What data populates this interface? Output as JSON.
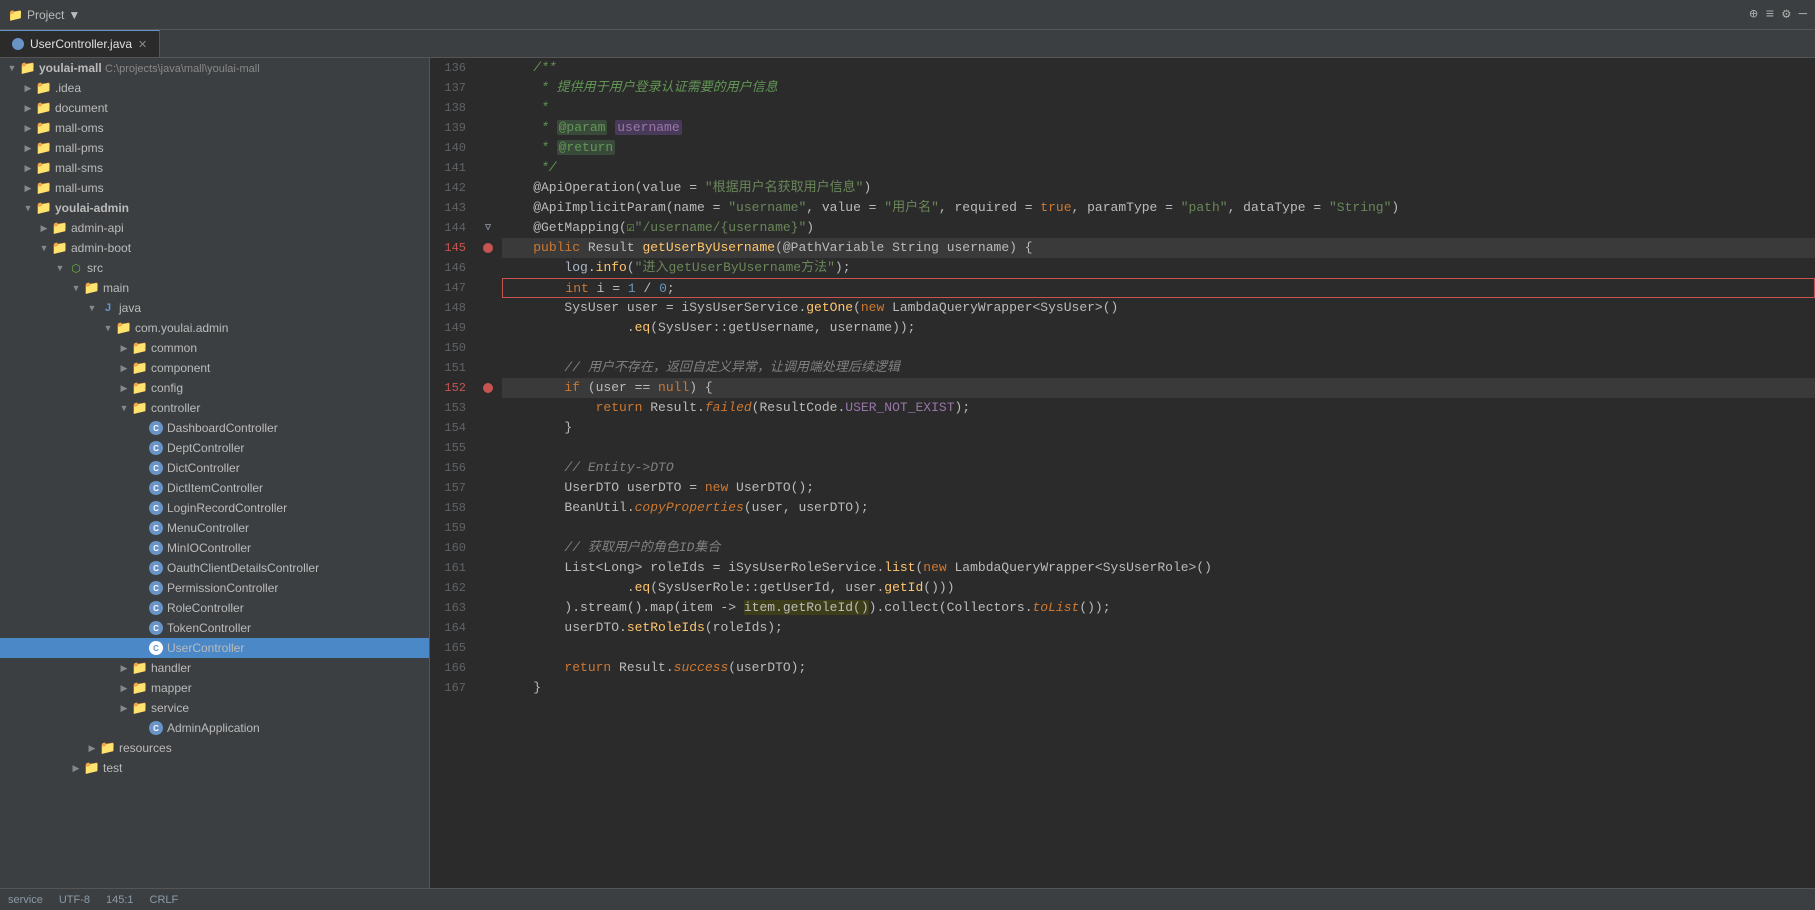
{
  "titleBar": {
    "projectLabel": "Project",
    "dropdownIcon": "▼"
  },
  "tabs": [
    {
      "label": "UserController.java",
      "active": true,
      "closeable": true
    }
  ],
  "sidebar": {
    "title": "Project",
    "tree": [
      {
        "indent": 0,
        "arrow": "▼",
        "icon": "folder",
        "label": "youlai-mall",
        "suffix": " C:\\projects\\java\\mall\\youlai-mall",
        "selected": false
      },
      {
        "indent": 1,
        "arrow": "▶",
        "icon": "folder",
        "label": ".idea",
        "selected": false
      },
      {
        "indent": 1,
        "arrow": "▶",
        "icon": "folder",
        "label": "document",
        "selected": false
      },
      {
        "indent": 1,
        "arrow": "▶",
        "icon": "folder",
        "label": "mall-oms",
        "selected": false
      },
      {
        "indent": 1,
        "arrow": "▶",
        "icon": "folder",
        "label": "mall-pms",
        "selected": false
      },
      {
        "indent": 1,
        "arrow": "▶",
        "icon": "folder",
        "label": "mall-sms",
        "selected": false
      },
      {
        "indent": 1,
        "arrow": "▶",
        "icon": "folder",
        "label": "mall-ums",
        "selected": false
      },
      {
        "indent": 1,
        "arrow": "▼",
        "icon": "folder",
        "label": "youlai-admin",
        "selected": false
      },
      {
        "indent": 2,
        "arrow": "▶",
        "icon": "folder",
        "label": "admin-api",
        "selected": false
      },
      {
        "indent": 2,
        "arrow": "▼",
        "icon": "folder",
        "label": "admin-boot",
        "selected": false
      },
      {
        "indent": 3,
        "arrow": "▼",
        "icon": "src",
        "label": "src",
        "selected": false
      },
      {
        "indent": 4,
        "arrow": "▼",
        "icon": "folder",
        "label": "main",
        "selected": false
      },
      {
        "indent": 5,
        "arrow": "▼",
        "icon": "folder",
        "label": "java",
        "selected": false
      },
      {
        "indent": 6,
        "arrow": "▼",
        "icon": "folder",
        "label": "com.youlai.admin",
        "selected": false
      },
      {
        "indent": 7,
        "arrow": "▶",
        "icon": "folder",
        "label": "common",
        "selected": false
      },
      {
        "indent": 7,
        "arrow": "▶",
        "icon": "folder",
        "label": "component",
        "selected": false
      },
      {
        "indent": 7,
        "arrow": "▶",
        "icon": "folder",
        "label": "config",
        "selected": false
      },
      {
        "indent": 7,
        "arrow": "▼",
        "icon": "folder",
        "label": "controller",
        "selected": false
      },
      {
        "indent": 8,
        "arrow": "",
        "icon": "controller",
        "label": "DashboardController",
        "selected": false
      },
      {
        "indent": 8,
        "arrow": "",
        "icon": "controller",
        "label": "DeptController",
        "selected": false
      },
      {
        "indent": 8,
        "arrow": "",
        "icon": "controller",
        "label": "DictController",
        "selected": false
      },
      {
        "indent": 8,
        "arrow": "",
        "icon": "controller",
        "label": "DictItemController",
        "selected": false
      },
      {
        "indent": 8,
        "arrow": "",
        "icon": "controller",
        "label": "LoginRecordController",
        "selected": false
      },
      {
        "indent": 8,
        "arrow": "",
        "icon": "controller",
        "label": "MenuController",
        "selected": false
      },
      {
        "indent": 8,
        "arrow": "",
        "icon": "controller",
        "label": "MinIOController",
        "selected": false
      },
      {
        "indent": 8,
        "arrow": "",
        "icon": "controller",
        "label": "OauthClientDetailsController",
        "selected": false
      },
      {
        "indent": 8,
        "arrow": "",
        "icon": "controller",
        "label": "PermissionController",
        "selected": false
      },
      {
        "indent": 8,
        "arrow": "",
        "icon": "controller",
        "label": "RoleController",
        "selected": false
      },
      {
        "indent": 8,
        "arrow": "",
        "icon": "controller",
        "label": "TokenController",
        "selected": false
      },
      {
        "indent": 8,
        "arrow": "",
        "icon": "controller",
        "label": "UserController",
        "selected": true
      },
      {
        "indent": 7,
        "arrow": "▶",
        "icon": "folder",
        "label": "handler",
        "selected": false
      },
      {
        "indent": 7,
        "arrow": "▶",
        "icon": "folder",
        "label": "mapper",
        "selected": false
      },
      {
        "indent": 7,
        "arrow": "▶",
        "icon": "folder",
        "label": "service",
        "selected": false
      },
      {
        "indent": 8,
        "arrow": "",
        "icon": "controller",
        "label": "AdminApplication",
        "selected": false
      },
      {
        "indent": 6,
        "arrow": "▶",
        "icon": "folder",
        "label": "resources",
        "selected": false
      },
      {
        "indent": 5,
        "arrow": "▶",
        "icon": "folder",
        "label": "test",
        "selected": false
      }
    ]
  },
  "editor": {
    "filename": "UserController.java",
    "lines": [
      {
        "num": 136,
        "content": "    /**",
        "type": "comment"
      },
      {
        "num": 137,
        "content": "     * 提供用于用户登录认证需要的用户信息",
        "type": "comment"
      },
      {
        "num": 138,
        "content": "     *",
        "type": "comment"
      },
      {
        "num": 139,
        "content": "     * @param username",
        "type": "comment-param"
      },
      {
        "num": 140,
        "content": "     * @return",
        "type": "comment-return"
      },
      {
        "num": 141,
        "content": "     */",
        "type": "comment"
      },
      {
        "num": 142,
        "content": "    @ApiOperation(value = \"根据用户名获取用户信息\")",
        "type": "annotation"
      },
      {
        "num": 143,
        "content": "    @ApiImplicitParam(name = \"username\", value = \"用户名\", required = true, paramType = \"path\", dataType = \"String\")",
        "type": "annotation"
      },
      {
        "num": 144,
        "content": "    @GetMapping(☑\"/username/{username}\")",
        "type": "annotation"
      },
      {
        "num": 145,
        "content": "    public Result getUserByUsername(@PathVariable String username) {",
        "type": "code",
        "breakpoint": true
      },
      {
        "num": 146,
        "content": "        log.info(\"进入getUserByUsername方法\");",
        "type": "code"
      },
      {
        "num": 147,
        "content": "        int i = 1 / 0;",
        "type": "code-error"
      },
      {
        "num": 148,
        "content": "        SysUser user = iSysUserService.getOne(new LambdaQueryWrapper<SysUser>()",
        "type": "code"
      },
      {
        "num": 149,
        "content": "                .eq(SysUser::getUsername, username));",
        "type": "code"
      },
      {
        "num": 150,
        "content": "",
        "type": "empty"
      },
      {
        "num": 151,
        "content": "        // 用户不存在，返回自定义异常，让调用端处理后续逻辑",
        "type": "comment-inline"
      },
      {
        "num": 152,
        "content": "        if (user == null) {",
        "type": "code",
        "breakpoint2": true
      },
      {
        "num": 153,
        "content": "            return Result.failed(ResultCode.USER_NOT_EXIST);",
        "type": "code"
      },
      {
        "num": 154,
        "content": "        }",
        "type": "code"
      },
      {
        "num": 155,
        "content": "",
        "type": "empty"
      },
      {
        "num": 156,
        "content": "        // Entity->DTO",
        "type": "comment-inline"
      },
      {
        "num": 157,
        "content": "        UserDTO userDTO = new UserDTO();",
        "type": "code"
      },
      {
        "num": 158,
        "content": "        BeanUtil.copyProperties(user, userDTO);",
        "type": "code"
      },
      {
        "num": 159,
        "content": "",
        "type": "empty"
      },
      {
        "num": 160,
        "content": "        // 获取用户的角色ID集合",
        "type": "comment-inline"
      },
      {
        "num": 161,
        "content": "        List<Long> roleIds = iSysUserRoleService.list(new LambdaQueryWrapper<SysUserRole>()",
        "type": "code"
      },
      {
        "num": 162,
        "content": "                .eq(SysUserRole::getUserId, user.getId())",
        "type": "code"
      },
      {
        "num": 163,
        "content": "        ).stream().map(item -> item.getRoleId()).collect(Collectors.toList());",
        "type": "code"
      },
      {
        "num": 164,
        "content": "        userDTO.setRoleIds(roleIds);",
        "type": "code"
      },
      {
        "num": 165,
        "content": "",
        "type": "empty"
      },
      {
        "num": 166,
        "content": "        return Result.success(userDTO);",
        "type": "code"
      },
      {
        "num": 167,
        "content": "    }",
        "type": "code"
      }
    ]
  },
  "statusBar": {
    "service": "service",
    "encoding": "UTF-8",
    "lineInfo": "145:1",
    "crlf": "CRLF"
  }
}
